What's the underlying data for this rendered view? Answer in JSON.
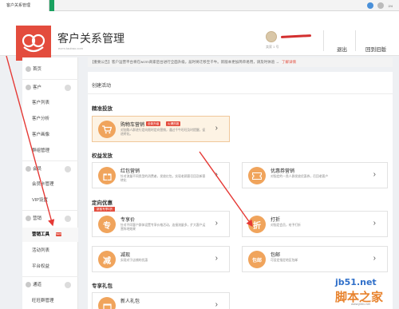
{
  "browser": {
    "tab_title": "客户关系管理",
    "accent_color": "#1aa260",
    "badge_text": "2/4"
  },
  "header": {
    "brand": "客户关系管理",
    "brand_sub": "ecrm.taobao.com",
    "user_sub": "卖家 1 号",
    "logout": "退出",
    "back_old": "回到旧版",
    "logo_color": "#e34c3d"
  },
  "sidebar": {
    "items": [
      {
        "label": "首页",
        "type": "group"
      },
      {
        "label": "客户",
        "type": "group"
      },
      {
        "label": "客户列表",
        "type": "sub"
      },
      {
        "label": "客户分析",
        "type": "sub"
      },
      {
        "label": "客户画像",
        "type": "sub"
      },
      {
        "label": "群组管理",
        "type": "sub"
      },
      {
        "label": "会员",
        "type": "group"
      },
      {
        "label": "会员卡管理",
        "type": "sub"
      },
      {
        "label": "VIP设置",
        "type": "sub"
      },
      {
        "label": "营销",
        "type": "group"
      },
      {
        "label": "营销工具",
        "type": "sub",
        "active": true,
        "badge": "NEW"
      },
      {
        "label": "活动列表",
        "type": "sub"
      },
      {
        "label": "平台权益",
        "type": "sub"
      },
      {
        "label": "通道",
        "type": "group"
      },
      {
        "label": "旺旺群管理",
        "type": "sub"
      }
    ]
  },
  "notice": {
    "text": "【重要公告】客户运营平台将在wcrm商家后台进行全面升级，届时将迁移至千牛。新版本更加简单易用，请及时体验 →",
    "link": "了解详情"
  },
  "main": {
    "page_title": "创建活动",
    "sections": {
      "precision": "精准投放",
      "benefit": "权益发放",
      "targeted": "定向优惠",
      "gift": "专享礼包"
    },
    "cards": {
      "cart": {
        "name": "购物车营销",
        "desc": "对加购人群进行定向限时定向营销，通过千牛旺旺及时提醒，促进转化。",
        "tag1": "全新升级",
        "tag2": "火爆热推",
        "icon": "cart"
      },
      "redpacket": {
        "name": "红包营销",
        "desc": "针对流量不同类型的消费者，发放红包，实现老顾客召回及新客转化",
        "icon": "gift"
      },
      "coupon": {
        "name": "优惠券营销",
        "desc": "对指定的一类人群发放优惠券，召回老客户",
        "icon": "ticket"
      },
      "exclusive": {
        "name": "专享价",
        "desc": "针对不同客户群体设置专享价格活动，连接流量多，扩大客户运营阵地效果",
        "ribbon": "新客专享5折",
        "icon": "专"
      },
      "discount": {
        "name": "打折",
        "desc": "对指定会员，给予打折",
        "icon": "折"
      },
      "reduce": {
        "name": "减现",
        "desc": "实现对于店铺的优惠",
        "icon": "减"
      },
      "freeship": {
        "name": "包邮",
        "desc": "可设定指定地区包邮",
        "icon": "包邮"
      },
      "newbie": {
        "name": "新人礼包",
        "icon": "gift"
      }
    },
    "icon_color": "#f0a45c",
    "highlight_bg": "#fdf3e4"
  },
  "watermark": {
    "site": "jb51.net",
    "name": "脚本之家",
    "url": "www.jb51.net"
  }
}
